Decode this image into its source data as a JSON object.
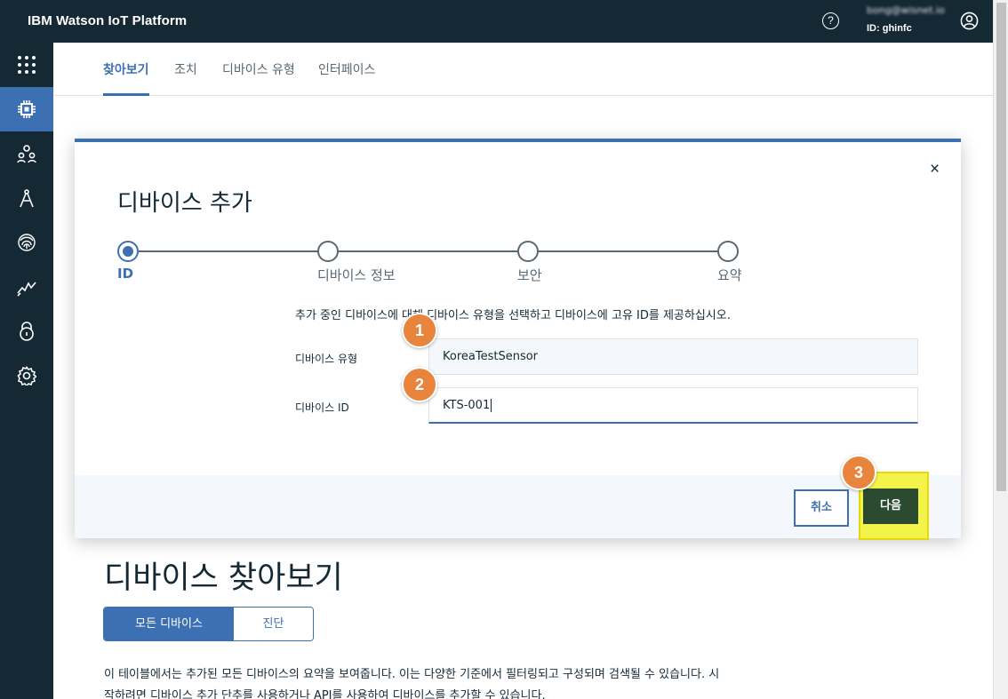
{
  "header": {
    "brand": "IBM Watson IoT Platform",
    "help_glyph": "?",
    "email": "bong@wisnet.io",
    "org_id": "ID: ghinfc"
  },
  "sidebar": {
    "items": [
      {
        "icon": "apps-grid-icon",
        "active": false
      },
      {
        "icon": "devices-chip-icon",
        "active": true
      },
      {
        "icon": "members-icon",
        "active": false
      },
      {
        "icon": "apps-compass-icon",
        "active": false
      },
      {
        "icon": "fingerprint-icon",
        "active": false
      },
      {
        "icon": "analytics-icon",
        "active": false
      },
      {
        "icon": "security-lock-icon",
        "active": false
      },
      {
        "icon": "settings-gear-icon",
        "active": false
      }
    ]
  },
  "tabs": [
    "찾아보기",
    "조치",
    "디바이스 유형",
    "인터페이스"
  ],
  "modal": {
    "title": "디바이스 추가",
    "close_glyph": "×",
    "steps": [
      "ID",
      "디바이스 정보",
      "보안",
      "요약"
    ],
    "current_step": 0,
    "intro": "추가 중인 디바이스에 대해 디바이스 유형을 선택하고 디바이스에 고유 ID를 제공하십시오.",
    "fields": {
      "device_type_label": "디바이스 유형",
      "device_type_value": "KoreaTestSensor",
      "device_id_label": "디바이스 ID",
      "device_id_value": "KTS-001"
    },
    "cancel_label": "취소",
    "next_label": "다음"
  },
  "annotations": [
    "1",
    "2",
    "3"
  ],
  "page": {
    "title": "디바이스 찾아보기",
    "toggle": [
      "모든 디바이스",
      "진단"
    ],
    "description": "이 테이블에서는 추가된 모든 디바이스의 요약을 보여줍니다. 이는 다양한 기준에서 필터링되고 구성되며 검색될 수 있습니다. 시작하려면 디바이스 추가 단추를 사용하거나 API를 사용하여 디바이스를 추가할 수 있습니다."
  },
  "colors": {
    "header_bg": "#152935",
    "accent": "#3d70b2",
    "badge": "#e8843c",
    "highlight": "#f4f34a",
    "next_button": "#2b4a2f"
  }
}
